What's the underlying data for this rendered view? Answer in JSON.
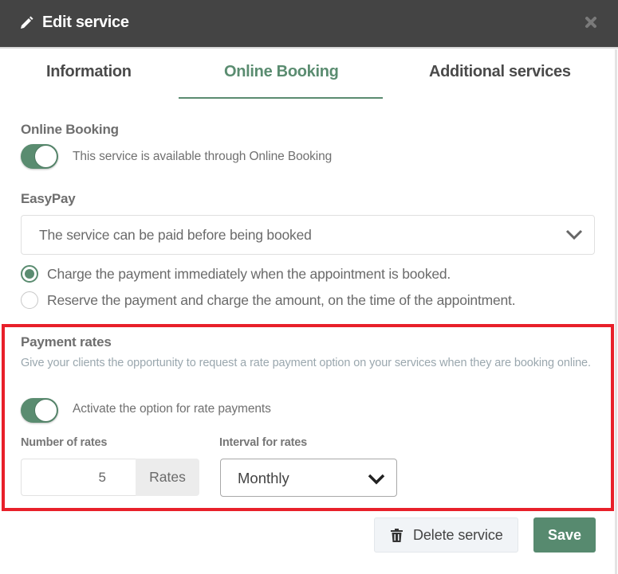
{
  "header": {
    "title": "Edit service",
    "title_icon": "pencil-icon",
    "close_icon": "close-icon"
  },
  "tabs": [
    {
      "label": "Information",
      "active": false
    },
    {
      "label": "Online Booking",
      "active": true
    },
    {
      "label": "Additional services",
      "active": false
    }
  ],
  "online_booking": {
    "label": "Online Booking",
    "toggle_on": true,
    "toggle_text": "This service is available through Online Booking"
  },
  "easypay": {
    "label": "EasyPay",
    "selected": "The service can be paid before being booked",
    "radio_options": [
      {
        "label": "Charge the payment immediately when the appointment is booked.",
        "checked": true
      },
      {
        "label": "Reserve the payment and charge the amount, on the time of the appointment.",
        "checked": false
      }
    ]
  },
  "payment_rates": {
    "label": "Payment rates",
    "hint": "Give your clients the opportunity to request a rate payment option on your services when they are booking online.",
    "toggle_on": true,
    "toggle_text": "Activate the option for rate payments",
    "number_label": "Number of rates",
    "number_value": "5",
    "number_addon": "Rates",
    "interval_label": "Interval for rates",
    "interval_value": "Monthly"
  },
  "footer": {
    "delete_label": "Delete service",
    "delete_icon": "trash-icon",
    "save_label": "Save"
  },
  "colors": {
    "accent": "#5a8c70",
    "header_bg": "#444444",
    "highlight": "#e8202a"
  }
}
